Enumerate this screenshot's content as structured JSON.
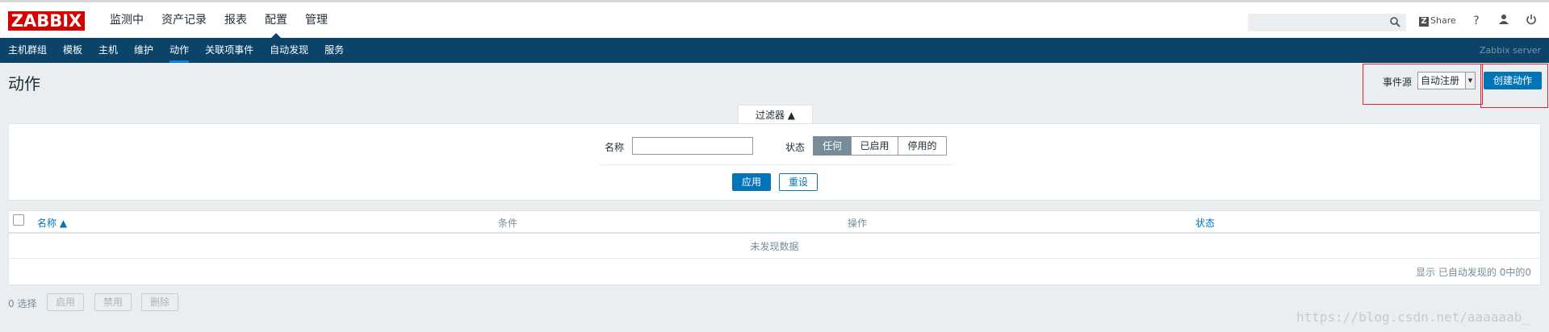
{
  "header": {
    "logo": "ZABBIX",
    "main_nav": [
      "监测中",
      "资产记录",
      "报表",
      "配置",
      "管理"
    ],
    "active_main": "配置",
    "search_placeholder": "",
    "share_label": "Share",
    "help_icon": "question-icon",
    "user_icon": "user-icon",
    "power_icon": "power-icon"
  },
  "subnav": {
    "items": [
      "主机群组",
      "模板",
      "主机",
      "维护",
      "动作",
      "关联项事件",
      "自动发现",
      "服务"
    ],
    "active": "动作",
    "server": "Zabbix server"
  },
  "page": {
    "title": "动作",
    "event_source_label": "事件源",
    "event_source_value": "自动注册",
    "create_button": "创建动作"
  },
  "filter": {
    "tab_label": "过滤器 ▲",
    "name_label": "名称",
    "name_value": "",
    "status_label": "状态",
    "status_options": [
      "任何",
      "已启用",
      "停用的"
    ],
    "status_selected": "任何",
    "apply_button": "应用",
    "reset_button": "重设"
  },
  "table": {
    "columns": [
      "名称 ▲",
      "条件",
      "操作",
      "状态"
    ],
    "empty_text": "未发现数据",
    "paging_text": "显示 已自动发现的 0中的0"
  },
  "footer": {
    "selected_count": "0 选择",
    "bulk_buttons": [
      "启用",
      "禁用",
      "删除"
    ]
  },
  "watermark": "https://blog.csdn.net/aaaaaab_",
  "colors": {
    "logo_red": "#d40000",
    "subnav_bg": "#0b4468",
    "primary_blue": "#0275b8",
    "highlight_red": "#e32636"
  }
}
